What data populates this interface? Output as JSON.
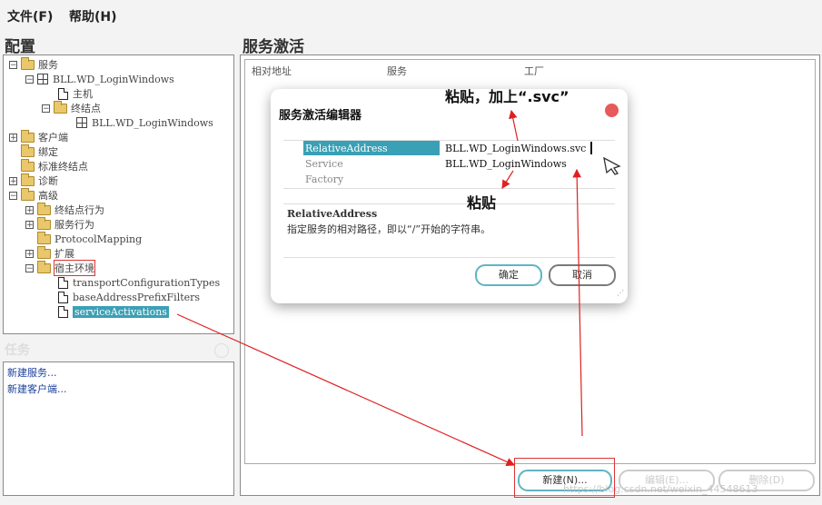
{
  "menu": {
    "file": "文件(F)",
    "help": "帮助(H)"
  },
  "config": {
    "title": "配置",
    "tree": [
      {
        "label": "服务"
      },
      {
        "label": "BLL.WD_LoginWindows"
      },
      {
        "label": "主机"
      },
      {
        "label": "终结点"
      },
      {
        "label": "BLL.WD_LoginWindows"
      },
      {
        "label": "客户端"
      },
      {
        "label": "绑定"
      },
      {
        "label": "标准终结点"
      },
      {
        "label": "诊断"
      },
      {
        "label": "高级"
      },
      {
        "label": "终结点行为"
      },
      {
        "label": "服务行为"
      },
      {
        "label": "ProtocolMapping"
      },
      {
        "label": "扩展"
      },
      {
        "label": "宿主环境"
      },
      {
        "label": "transportConfigurationTypes"
      },
      {
        "label": "baseAddressPrefixFilters"
      },
      {
        "label": "serviceActivations"
      }
    ]
  },
  "tasks": {
    "title": "任务",
    "items": [
      "新建服务...",
      "新建客户端..."
    ]
  },
  "main": {
    "title": "服务激活",
    "columns": [
      "相对地址",
      "服务",
      "工厂"
    ],
    "buttons": {
      "new": "新建(N)...",
      "edit": "编辑(E)...",
      "delete": "删除(D)"
    }
  },
  "dialog": {
    "title": "服务激活编辑器",
    "props": [
      {
        "name": "RelativeAddress",
        "value": "BLL.WD_LoginWindows.svc"
      },
      {
        "name": "Service",
        "value": "BLL.WD_LoginWindows"
      },
      {
        "name": "Factory",
        "value": ""
      }
    ],
    "desc_title": "RelativeAddress",
    "desc_text": "指定服务的相对路径，即以“/”开始的字符串。",
    "ok": "确定",
    "cancel": "取消"
  },
  "annotations": {
    "top": "粘贴，加上“.svc”",
    "middle": "粘贴"
  },
  "watermark": "https://blog.csdn.net/weixin_44548613",
  "colors": {
    "selection": "#3aa0b5",
    "arrow": "#e02020",
    "close": "#e85a5a"
  }
}
